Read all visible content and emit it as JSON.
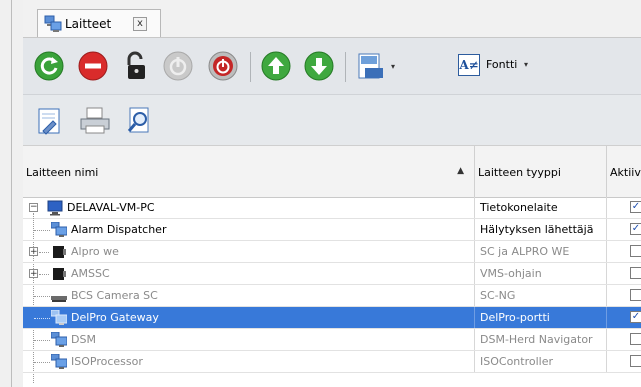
{
  "tab": {
    "label": "Laitteet",
    "close": "x"
  },
  "toolbar": {
    "font_label": "Fontti",
    "font_icon_text": "A≠",
    "dropdown_glyph": "▾"
  },
  "grid": {
    "columns": {
      "name": "Laitteen nimi",
      "type": "Laitteen tyyppi",
      "active": "Aktiiv"
    },
    "sort_glyph": "▲",
    "expand_glyph": "−",
    "collapsed_glyph": "+",
    "check_glyph": "✓",
    "rows": [
      {
        "name": "DELAVAL-VM-PC",
        "type": "Tietokonelaite",
        "active": true,
        "icon": "computer-icon"
      },
      {
        "name": "Alarm Dispatcher",
        "type": "Hälytyksen lähettäjä",
        "active": true,
        "icon": "device-icon"
      },
      {
        "name": "Alpro we",
        "type": "SC ja ALPRO WE",
        "active": false,
        "icon": "controller-icon"
      },
      {
        "name": "AMSSC",
        "type": "VMS-ohjain",
        "active": false,
        "icon": "controller-icon"
      },
      {
        "name": "BCS Camera SC",
        "type": "SC-NG",
        "active": false,
        "icon": "camera-icon"
      },
      {
        "name": "DelPro Gateway",
        "type": "DelPro-portti",
        "active": true,
        "icon": "device-icon"
      },
      {
        "name": "DSM",
        "type": "DSM-Herd Navigator",
        "active": false,
        "icon": "device-icon"
      },
      {
        "name": "ISOProcessor",
        "type": "ISOController",
        "active": false,
        "icon": "device-icon"
      }
    ]
  },
  "colors": {
    "selection": "#3879d9",
    "refresh": "#3aa23a",
    "stop": "#d92b2b",
    "arrow_green": "#3fa83f"
  }
}
